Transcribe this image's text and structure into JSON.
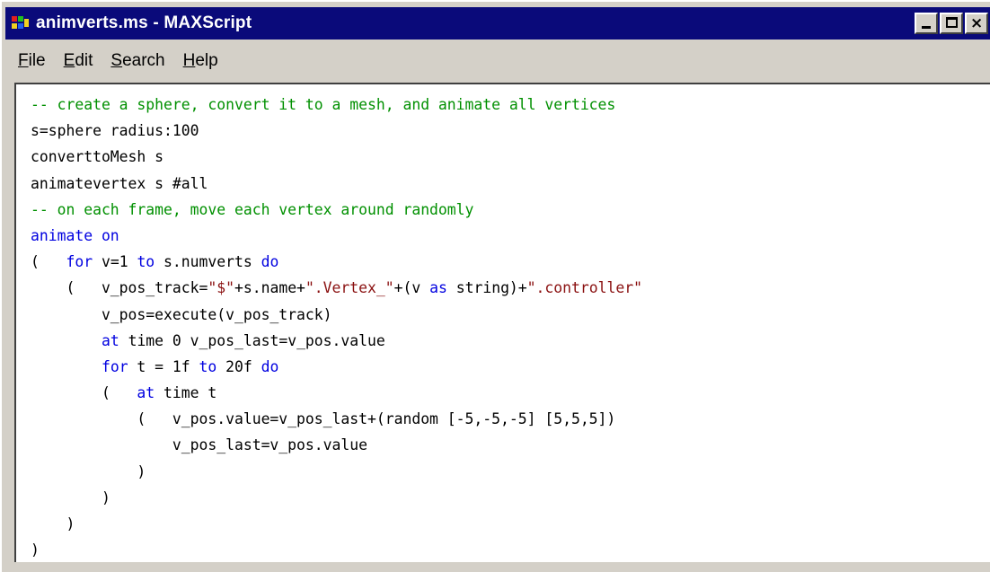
{
  "window": {
    "title": "animverts.ms - MAXScript",
    "buttons": {
      "minimize": "minimize",
      "maximize": "maximize",
      "close": "close"
    }
  },
  "menu": [
    {
      "id": "file",
      "mnemonic": "F",
      "rest": "ile"
    },
    {
      "id": "edit",
      "mnemonic": "E",
      "rest": "dit"
    },
    {
      "id": "search",
      "mnemonic": "S",
      "rest": "earch"
    },
    {
      "id": "help",
      "mnemonic": "H",
      "rest": "elp"
    }
  ],
  "colors": {
    "titlebar": "#0a0a7a",
    "comment": "#009000",
    "keyword": "#0000e0",
    "string": "#8a1010"
  },
  "code_lines": [
    [
      [
        "comment",
        "-- create a sphere, convert it to a mesh, and animate all vertices"
      ]
    ],
    [
      [
        "plain",
        "s=sphere radius:100"
      ]
    ],
    [
      [
        "plain",
        "converttoMesh s"
      ]
    ],
    [
      [
        "plain",
        "animatevertex s #all"
      ]
    ],
    [
      [
        "comment",
        "-- on each frame, move each vertex around randomly"
      ]
    ],
    [
      [
        "keyword",
        "animate on"
      ]
    ],
    [
      [
        "plain",
        "(   "
      ],
      [
        "keyword",
        "for"
      ],
      [
        "plain",
        " v=1 "
      ],
      [
        "keyword",
        "to"
      ],
      [
        "plain",
        " s.numverts "
      ],
      [
        "keyword",
        "do"
      ]
    ],
    [
      [
        "plain",
        "    (   v_pos_track="
      ],
      [
        "string",
        "\"$\""
      ],
      [
        "plain",
        "+s.name+"
      ],
      [
        "string",
        "\".Vertex_\""
      ],
      [
        "plain",
        "+(v "
      ],
      [
        "keyword",
        "as"
      ],
      [
        "plain",
        " string)+"
      ],
      [
        "string",
        "\".controller\""
      ]
    ],
    [
      [
        "plain",
        "        v_pos=execute(v_pos_track)"
      ]
    ],
    [
      [
        "plain",
        "        "
      ],
      [
        "keyword",
        "at"
      ],
      [
        "plain",
        " time 0 v_pos_last=v_pos.value"
      ]
    ],
    [
      [
        "plain",
        "        "
      ],
      [
        "keyword",
        "for"
      ],
      [
        "plain",
        " t = 1f "
      ],
      [
        "keyword",
        "to"
      ],
      [
        "plain",
        " 20f "
      ],
      [
        "keyword",
        "do"
      ]
    ],
    [
      [
        "plain",
        "        (   "
      ],
      [
        "keyword",
        "at"
      ],
      [
        "plain",
        " time t"
      ]
    ],
    [
      [
        "plain",
        "            (   v_pos.value=v_pos_last+(random [-5,-5,-5] [5,5,5])"
      ]
    ],
    [
      [
        "plain",
        "                v_pos_last=v_pos.value"
      ]
    ],
    [
      [
        "plain",
        "            )"
      ]
    ],
    [
      [
        "plain",
        "        )"
      ]
    ],
    [
      [
        "plain",
        "    )"
      ]
    ],
    [
      [
        "plain",
        ")"
      ]
    ]
  ]
}
